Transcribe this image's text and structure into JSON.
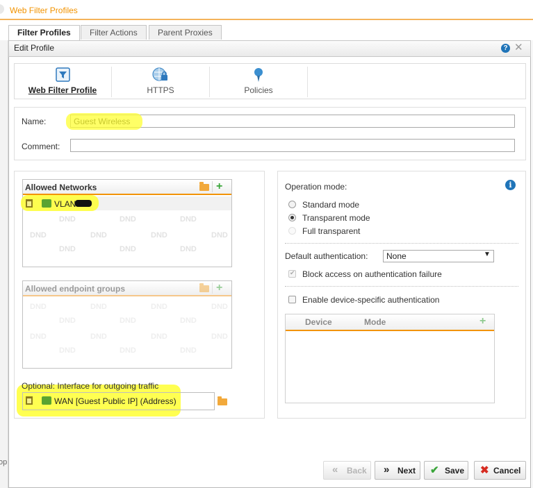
{
  "app": {
    "title": "Web Filter Profiles"
  },
  "tabs": [
    {
      "label": "Filter Profiles",
      "active": true
    },
    {
      "label": "Filter Actions",
      "active": false
    },
    {
      "label": "Parent Proxies",
      "active": false
    }
  ],
  "edge_text": "op",
  "dialog": {
    "title": "Edit Profile",
    "help_icon_glyph": "?",
    "close_icon_glyph": "✕"
  },
  "steps": [
    {
      "label": "Web Filter Profile",
      "icon": "filter-icon",
      "active": true
    },
    {
      "label": "HTTPS",
      "icon": "globe-lock-icon",
      "active": false
    },
    {
      "label": "Policies",
      "icon": "pin-icon",
      "active": false
    }
  ],
  "form": {
    "name_label": "Name:",
    "name_value": "Guest Wireless",
    "comment_label": "Comment:",
    "comment_value": ""
  },
  "allowed_networks": {
    "title": "Allowed Networks",
    "items": [
      {
        "label": "VLAN"
      }
    ]
  },
  "allowed_endpoint_groups": {
    "title": "Allowed endpoint groups",
    "items": []
  },
  "dnd_text": "DND",
  "outgoing": {
    "label": "Optional: Interface for outgoing traffic",
    "value": "WAN [Guest Public IP] (Address)"
  },
  "operation": {
    "label": "Operation mode:",
    "info_glyph": "i",
    "modes": [
      {
        "label": "Standard mode",
        "checked": false,
        "disabled": false
      },
      {
        "label": "Transparent mode",
        "checked": true,
        "disabled": false
      },
      {
        "label": "Full transparent",
        "checked": false,
        "disabled": true
      }
    ]
  },
  "auth": {
    "label": "Default authentication:",
    "value": "None",
    "block_label": "Block access on authentication failure",
    "block_checked": true,
    "block_disabled": true
  },
  "device": {
    "enable_label": "Enable device-specific authentication",
    "enable_checked": false,
    "columns": [
      "Device",
      "Mode"
    ]
  },
  "buttons": {
    "back": {
      "label": "Back",
      "icon": "«"
    },
    "next": {
      "label": "Next",
      "icon": "»"
    },
    "save": {
      "label": "Save",
      "icon": "✔"
    },
    "cancel": {
      "label": "Cancel",
      "icon": "✖"
    }
  },
  "colors": {
    "accent": "#f29300",
    "highlight": "#ffff33",
    "link_blue": "#1f74b8",
    "plus_green": "#3aa53a",
    "cancel_red": "#d62b20"
  }
}
